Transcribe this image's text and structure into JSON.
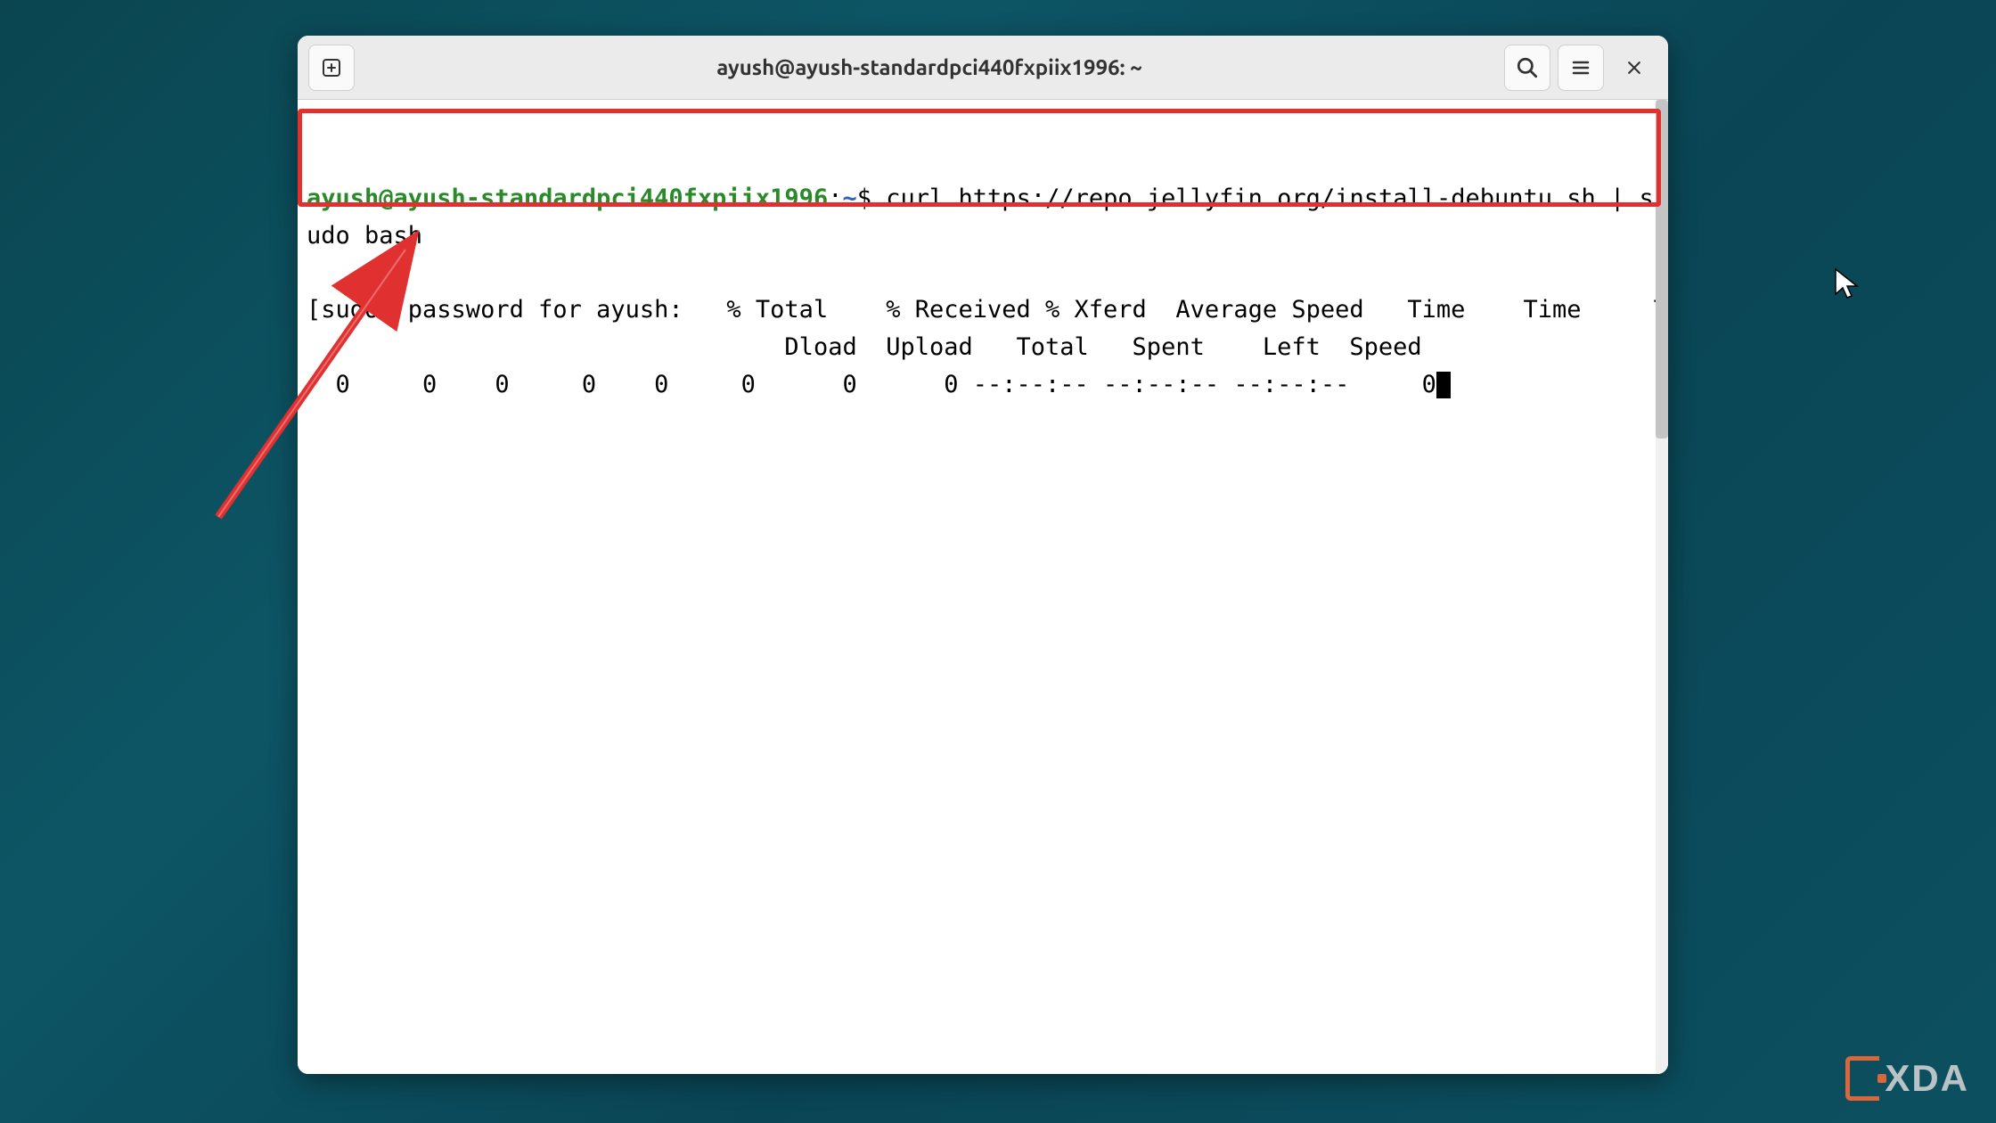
{
  "window": {
    "title": "ayush@ayush-standardpci440fxpiix1996: ~"
  },
  "prompt": {
    "user_host": "ayush@ayush-standardpci440fxpiix1996",
    "sep": ":",
    "path": "~",
    "dollar": "$"
  },
  "command": "curl https://repo.jellyfin.org/install-debuntu.sh | sudo bash",
  "output": {
    "line1": "[sudo] password for ayush:   % Total    % Received % Xferd  Average Speed   Time    Time     Time  Current",
    "line2": "                                 Dload  Upload   Total   Spent    Left  Speed",
    "line3": "  0     0    0     0    0     0      0      0 --:--:-- --:--:-- --:--:--     0"
  },
  "watermark": "XDA"
}
